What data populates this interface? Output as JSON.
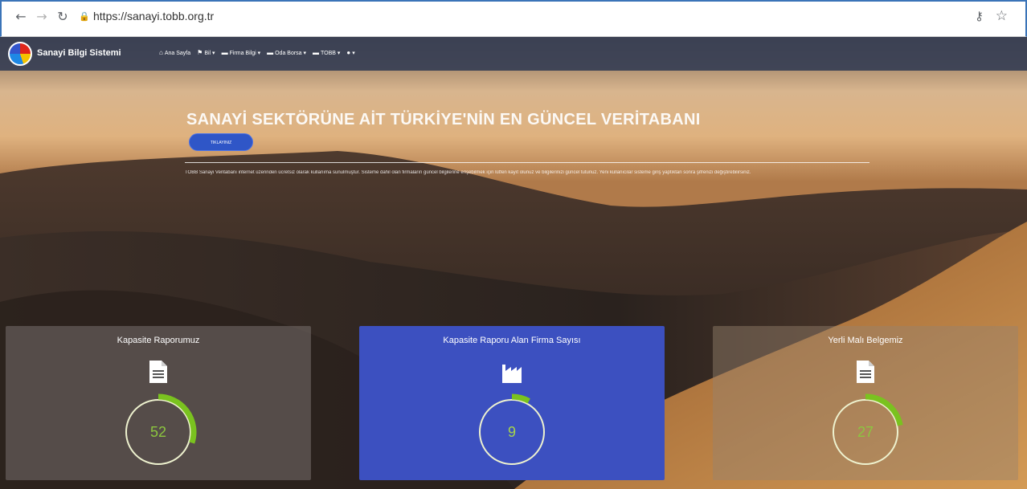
{
  "browser": {
    "url": "https://sanayi.tobb.org.tr",
    "back_icon": "arrow-left",
    "forward_icon": "arrow-right",
    "reload_icon": "reload",
    "lock_icon": "lock",
    "key_icon": "key",
    "star_icon": "star"
  },
  "navbar": {
    "brand": "Sanayi Bilgi Sistemi",
    "items": [
      {
        "icon": "home-icon",
        "label": "Ana Sayfa"
      },
      {
        "icon": "flag-icon",
        "label": "Bil ▾"
      },
      {
        "icon": "folder-icon",
        "label": "Firma Bilgi ▾"
      },
      {
        "icon": "folder-icon",
        "label": "Oda Borsa ▾"
      },
      {
        "icon": "folder-icon",
        "label": "TOBB ▾"
      },
      {
        "icon": "user-icon",
        "label": "▾"
      }
    ]
  },
  "hero": {
    "title": "SANAYİ SEKTÖRÜNE AİT TÜRKİYE'NİN EN GÜNCEL VERİTABANI",
    "button_label": "TIKLAYINIZ",
    "text": "TOBB Sanayi Veritabanı internet üzerinden ücretsiz olarak kullanıma sunulmuştur. Sisteme dahil olan firmaların güncel bilgilerine erişebilmek için lütfen kayıt olunuz ve bilgilerinizi güncel tutunuz. Yeni kullanıcılar sisteme giriş yaptıktan sonra şifrenizi değiştirebilirsiniz."
  },
  "cards": [
    {
      "title": "Kapasite Raporumuz",
      "value": "52",
      "icon": "document-icon",
      "progress": 0.3
    },
    {
      "title": "Kapasite Raporu Alan Firma Sayısı",
      "value": "9",
      "icon": "factory-icon",
      "progress": 0.08
    },
    {
      "title": "Yerli Malı Belgemiz",
      "value": "27",
      "icon": "document-icon",
      "progress": 0.22
    }
  ],
  "colors": {
    "navbar": "#363e54",
    "accent_blue": "#3c50c0",
    "gauge_green": "#8cc63f",
    "gauge_ring": "#e8f0c8"
  }
}
